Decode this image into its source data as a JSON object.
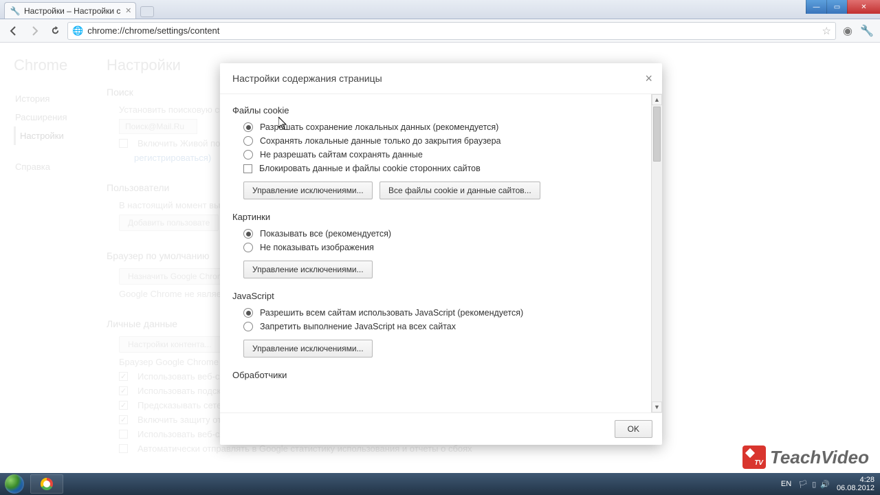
{
  "window": {
    "tab_title": "Настройки – Настройки с",
    "url": "chrome://chrome/settings/content"
  },
  "sidebar": {
    "brand": "Chrome",
    "items": [
      "История",
      "Расширения",
      "Настройки",
      "Справка"
    ],
    "active_index": 2
  },
  "settings": {
    "title": "Настройки",
    "search": {
      "heading": "Поиск",
      "desc": "Установить поисковую си",
      "engine": "Поиск@Mail.Ru",
      "live_search": "Включить Живой пои",
      "register_link": "регистрироваться)"
    },
    "users": {
      "heading": "Пользователи",
      "desc": "В настоящий момент вы",
      "add_btn": "Добавить пользовате"
    },
    "default_browser": {
      "heading": "Браузер по умолчанию",
      "btn": "Назначить Google Chrom",
      "note": "Google Chrome не являет"
    },
    "personal": {
      "heading": "Личные данные",
      "btn": "Настройки контента...",
      "note": "Браузер Google Chrome м более удобной и приятно",
      "opts": [
        "Использовать веб-слу",
        "Использовать подсказ",
        "Предсказывать сетевы",
        "Включить защиту от ф",
        "Использовать веб-слу",
        "Автоматически отправлять в Google статистику использования и отчеты о сбоях"
      ]
    }
  },
  "modal": {
    "title": "Настройки содержания страницы",
    "cookies": {
      "heading": "Файлы cookie",
      "opt1": "Разрешать сохранение локальных данных (рекомендуется)",
      "opt2": "Сохранять локальные данные только до закрытия браузера",
      "opt3": "Не разрешать сайтам сохранять данные",
      "block_third": "Блокировать данные и файлы cookie сторонних сайтов",
      "btn_exc": "Управление исключениями...",
      "btn_all": "Все файлы cookie и данные сайтов..."
    },
    "images": {
      "heading": "Картинки",
      "opt1": "Показывать все (рекомендуется)",
      "opt2": "Не показывать изображения",
      "btn_exc": "Управление исключениями..."
    },
    "js": {
      "heading": "JavaScript",
      "opt1": "Разрешить всем сайтам использовать JavaScript (рекомендуется)",
      "opt2": "Запретить выполнение JavaScript на всех сайтах",
      "btn_exc": "Управление исключениями..."
    },
    "handlers": {
      "heading": "Обработчики"
    },
    "ok": "OK"
  },
  "taskbar": {
    "lang": "EN",
    "time": "4:28",
    "date": "06.08.2012"
  },
  "watermark": "TeachVideo"
}
